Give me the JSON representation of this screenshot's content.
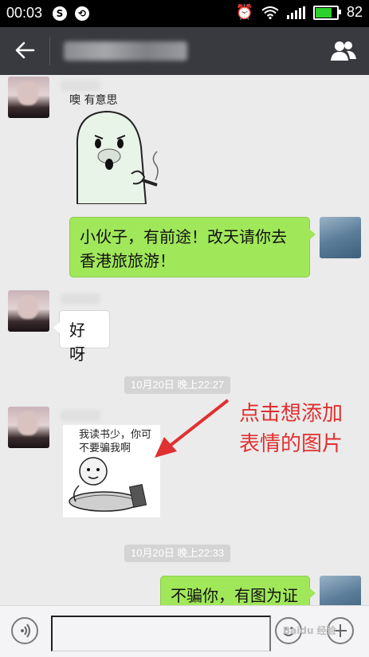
{
  "status_bar": {
    "time": "00:03",
    "battery_level": "82",
    "icons": [
      "alarm-icon",
      "wifi-icon",
      "signal-icon",
      "battery-icon"
    ]
  },
  "title_bar": {
    "back_icon": "arrow-left-icon",
    "title": "",
    "group_icon": "group-members-icon"
  },
  "messages": [
    {
      "side": "left",
      "nickname": "",
      "type": "sticker",
      "sticker_caption": "噢 有意思"
    },
    {
      "side": "right",
      "type": "text",
      "text_lines": [
        "小伙子，有前途！改天请你去",
        "香港旅旅游！"
      ]
    },
    {
      "side": "left",
      "nickname": "",
      "type": "text",
      "text": "好呀"
    },
    {
      "type": "timestamp",
      "text": "10月20日 晚上22:27"
    },
    {
      "side": "left",
      "nickname": "",
      "type": "sticker",
      "sticker_caption_lines": [
        "我读书少，你可",
        "不要骗我啊"
      ]
    },
    {
      "type": "timestamp",
      "text": "10月20日 晚上22:33"
    },
    {
      "side": "right",
      "type": "text",
      "text": "不骗你，有图为证"
    }
  ],
  "annotation": {
    "lines": [
      "点击想添加",
      "表情的图片"
    ],
    "color": "#e03030"
  },
  "input_bar": {
    "voice_icon": "voice-icon",
    "emoji_icon": "emoji-icon",
    "plus_icon": "plus-icon",
    "placeholder": ""
  },
  "watermark": "Baidu 经验"
}
